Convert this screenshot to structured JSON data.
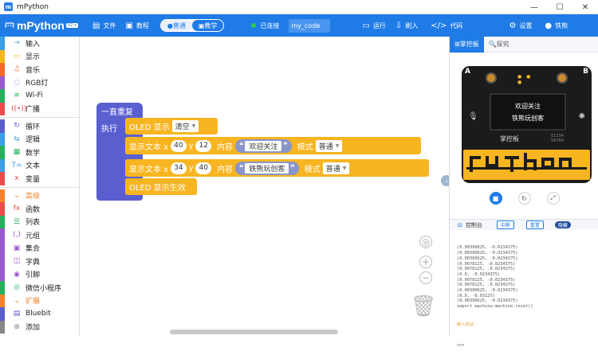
{
  "window": {
    "title": "mPython",
    "min": "—",
    "max": "☐",
    "close": "✕"
  },
  "toolbar": {
    "logo_text": "mPython",
    "version_badge": "V2.x",
    "file_label": "文件",
    "tutorial_label": "教程",
    "mode_normal": "普通",
    "mode_teach": "教学",
    "connection_status": "已连接",
    "filename": "my_code",
    "run_label": "运行",
    "upload_label": "刷入",
    "code_label": "代码",
    "settings_label": "设置",
    "user_label": "铁熊"
  },
  "sidebar": {
    "items": [
      {
        "label": "输入",
        "icon": "→",
        "color": "#3aa0e8"
      },
      {
        "label": "显示",
        "icon": "▭",
        "color": "#f7b521"
      },
      {
        "label": "音乐",
        "icon": "♫",
        "color": "#f56a2a"
      },
      {
        "label": "RGB灯",
        "icon": "◌",
        "color": "#9b59d0"
      },
      {
        "label": "Wi-Fi",
        "icon": "≋",
        "color": "#25b05e"
      },
      {
        "label": "广播",
        "icon": "((•))",
        "color": "#e94c4c"
      },
      {
        "label": "循环",
        "icon": "↻",
        "color": "#5a5fd0"
      },
      {
        "label": "逻辑",
        "icon": "⇆",
        "color": "#3aa0e8"
      },
      {
        "label": "数学",
        "icon": "▦",
        "color": "#25b05e"
      },
      {
        "label": "文本",
        "icon": "T=",
        "color": "#3aa0e8"
      },
      {
        "label": "变量",
        "icon": "x",
        "color": "#e94c4c"
      },
      {
        "label": "高级",
        "icon": "⌄",
        "color": "#f5812b",
        "header": true
      },
      {
        "label": "函数",
        "icon": "fx",
        "color": "#e94c4c"
      },
      {
        "label": "列表",
        "icon": "☰",
        "color": "#25b05e"
      },
      {
        "label": "元组",
        "icon": "(,)",
        "color": "#9b59d0"
      },
      {
        "label": "集合",
        "icon": "▣",
        "color": "#9b59d0"
      },
      {
        "label": "字典",
        "icon": "◫",
        "color": "#9b59d0"
      },
      {
        "label": "引脚",
        "icon": "◉",
        "color": "#9b59d0"
      },
      {
        "label": "微信小程序",
        "icon": "◎",
        "color": "#25b05e"
      },
      {
        "label": "扩展",
        "icon": "⌄",
        "color": "#f5812b",
        "header": true
      },
      {
        "label": "Bluebit",
        "icon": "▤",
        "color": "#5a5fd0"
      },
      {
        "label": "添加",
        "icon": "⊕",
        "color": "#888888"
      }
    ]
  },
  "blocks": {
    "forever_line1": "一直重复",
    "forever_line2": "执行",
    "oled_show": "OLED 显示",
    "oled_clear": "清空",
    "text1": {
      "prefix": "显示文本 x",
      "x": "40",
      "y_label": "y",
      "y": "12",
      "content_label": "内容",
      "content": "欢迎关注",
      "mode_label": "模式",
      "mode": "普通"
    },
    "text2": {
      "prefix": "显示文本 x",
      "x": "34",
      "y_label": "y",
      "y": "40",
      "content_label": "内容",
      "content": "铁熊玩创客",
      "mode_label": "模式",
      "mode": "普通"
    },
    "oled_apply": "OLED 显示生效"
  },
  "panel": {
    "tab_control": "掌控板",
    "tab_explore": "探究",
    "pad_a": "A",
    "pad_b": "B",
    "screen_line1": "欢迎关注",
    "screen_line2": "铁熊玩创客",
    "board_brand": "掌控板",
    "board_serial": "01234\n56789",
    "console_title": "控制台",
    "console_btn_interrupt": "中断",
    "console_btn_reset": "重置",
    "console_btn_toggle": "隐藏",
    "console_lines": "(0.00390625, -0.0234375)\n(0.00390625, -0.0234375)\n(0.00390625, -0.0234375)\n(0.0078125, -0.0234375)\n(0.0078125, -0.0234375)\n(0.0, -0.0234375)\n(0.0078125, -0.0234375)\n(0.0078125, -0.0234375)\n(0.00390625, -0.0234375)\n(0.0, -0.03125)\n(0.00390625, -0.0234375)\nimport machine;machine.reset()",
    "console_success": "刷入成功",
    "console_prompt": ">>>"
  }
}
